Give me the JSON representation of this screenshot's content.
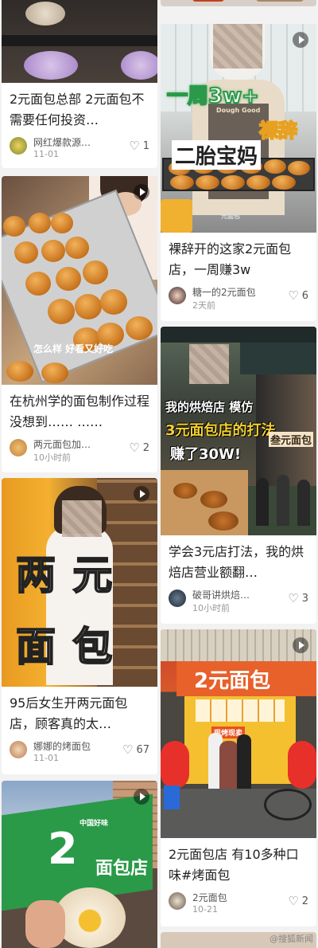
{
  "feed": {
    "cards": [
      {
        "title": "2元面包总部 2元面包不需要任何投资…",
        "author": "网红爆款源…",
        "date": "11-01",
        "likes": "1",
        "video": false
      },
      {
        "title": "在杭州学的面包制作过程没想到…… ……",
        "author": "两元面包加…",
        "date": "10小时前",
        "likes": "2",
        "video": true,
        "caption": "怎么样 好看又好吃"
      },
      {
        "title": "95后女生开两元面包店，顾客真的太…",
        "author": "娜娜的烤面包",
        "date": "11-01",
        "likes": "67",
        "video": true,
        "overlay_line1": "两 元",
        "overlay_line2": "面 包"
      },
      {
        "video": true,
        "sign_text": "2 面包店",
        "sign_small": "中国好味"
      },
      {
        "title": "裸辞开的这家2元面包店，一周赚3w",
        "author": "糖一的2元面包",
        "date": "2天前",
        "likes": "6",
        "video": true,
        "overlay_line1": "一周3w+",
        "overlay_line2": "裸辞",
        "overlay_line3": "二胎宝妈",
        "apron": "Dough Good",
        "small_text": "元面包"
      },
      {
        "title": "学会3元店打法，我的烘焙店营业额翻…",
        "author": "破哥讲烘焙…",
        "date": "10小时前",
        "likes": "3",
        "video": false,
        "overlay_line1": "我的烘焙店 模仿",
        "overlay_line2": "3元面包店的打法",
        "overlay_line3": "赚了30W!",
        "shop_sign": "叁元面包"
      },
      {
        "title": "2元面包店 有10多种口味#烤面包",
        "author": "2元面包",
        "date": "10-21",
        "likes": "2",
        "video": true,
        "shop_sign": "2元面包",
        "banner": "现烤现卖"
      }
    ],
    "watermark": "@搜狐新闻"
  }
}
